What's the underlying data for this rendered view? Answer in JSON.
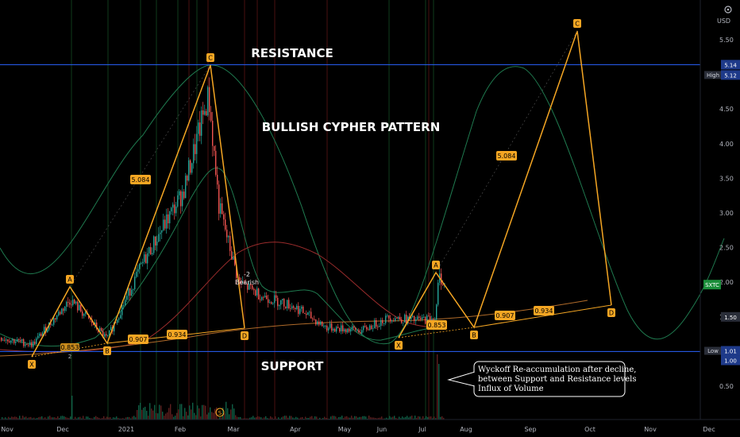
{
  "chart_data": {
    "type": "candlestick",
    "price_axis": {
      "unit_label": "USD",
      "ticks": [
        "5.50",
        "5.00",
        "4.50",
        "4.00",
        "3.50",
        "3.00",
        "2.50",
        "2.00",
        "1.50",
        "0.50"
      ]
    },
    "time_axis": {
      "ticks": [
        "Nov",
        "Dec",
        "2021",
        "Feb",
        "Mar",
        "Apr",
        "May",
        "Jun",
        "Jul",
        "Aug",
        "Sep",
        "Oct",
        "Nov",
        "Dec"
      ]
    },
    "price_tags": [
      {
        "label": "",
        "value": "5.14",
        "color": "#1e3a8a"
      },
      {
        "label": "High",
        "value": "5.12",
        "color": "#1e3a8a"
      },
      {
        "label": "",
        "value": "1.50",
        "color": "#2a2e39"
      },
      {
        "label": "Low",
        "value": "1.01",
        "color": "#1e3a8a"
      },
      {
        "label": "",
        "value": "1.00",
        "color": "#1e3a8a"
      }
    ],
    "symbol_tag": {
      "text": "SXTC",
      "color": "#1b8e3a"
    },
    "annotations": {
      "resistance": "RESISTANCE",
      "pattern": "BULLISH CYPHER PATTERN",
      "support": "SUPPORT",
      "bearish_marker": "-2",
      "bearish_label": "Bearish",
      "event_marker": "S",
      "note_lines": [
        "Wyckoff Re-accumulation after decline,",
        "between Support and Resistance levels",
        "Influx of Volume"
      ]
    },
    "pattern_1": {
      "points": [
        {
          "label": "X",
          "x": "Nov 25",
          "price": 1.1
        },
        {
          "label": "A",
          "x": "Dec 02",
          "price": 1.8
        },
        {
          "label": "B",
          "x": "Dec 20",
          "price": 1.15
        },
        {
          "label": "C",
          "x": "Feb 18",
          "price": 5.12
        },
        {
          "label": "D",
          "x": "Mar 02",
          "price": 1.45
        }
      ],
      "ratios": [
        "5.084",
        "0.907",
        "0.934"
      ]
    },
    "pattern_2": {
      "points": [
        {
          "label": "X",
          "x": "Jun 20",
          "price": 1.3
        },
        {
          "label": "A",
          "x": "Jul 10",
          "price": 2.15
        },
        {
          "label": "B",
          "x": "Aug 02",
          "price": 1.45
        },
        {
          "label": "C",
          "x": "Sep 25",
          "price": 5.5
        },
        {
          "label": "D",
          "x": "Oct 20",
          "price": 1.75
        }
      ],
      "ratios": [
        "5.084",
        "0.907",
        "0.934",
        "0.853"
      ]
    },
    "small_labels": [
      "0.853",
      "2"
    ],
    "colors": {
      "pattern": "#f5a623",
      "resistance_line": "#2962ff",
      "up": "#26a69a",
      "down": "#ef5350",
      "bb_green": "#1f7a4f",
      "bb_red": "#9b2c2c"
    }
  }
}
